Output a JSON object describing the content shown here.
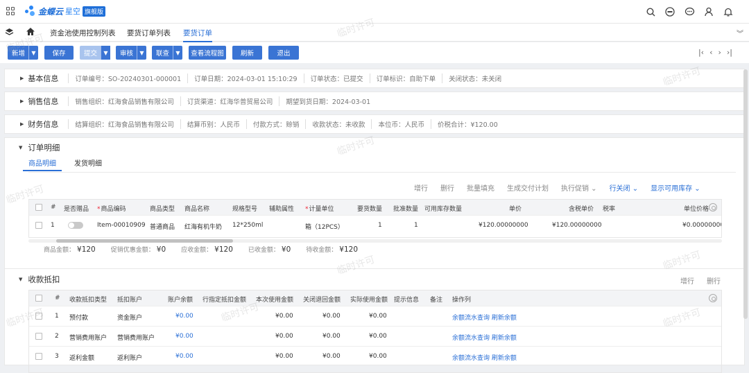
{
  "brand": {
    "name": "金蝶云",
    "sub": "星空",
    "badge": "旗舰版"
  },
  "tabs": [
    "资金池使用控制列表",
    "要货订单列表",
    "要货订单"
  ],
  "toolbar": {
    "new": "新增",
    "save": "保存",
    "submit": "提交",
    "audit": "审核",
    "link": "联查",
    "flow": "查看流程图",
    "refresh": "刷新",
    "exit": "退出"
  },
  "basic": {
    "title": "基本信息",
    "order_no": "订单编号：SO-20240301-000001",
    "order_date": "订单日期：2024-03-01 15:10:29",
    "order_status": "订单状态：已提交",
    "order_mark": "订单标识：自助下单",
    "close_status": "关闭状态：未关闭"
  },
  "sales": {
    "title": "销售信息",
    "org": "销售组织：红海食品销售有限公司",
    "channel": "订货渠道：红海华普贸易公司",
    "expected": "期望到货日期：2024-03-01"
  },
  "finance": {
    "title": "财务信息",
    "settle_org": "结算组织：红海食品销售有限公司",
    "currency": "结算币别：人民币",
    "pay": "付款方式：赊销",
    "collect": "收款状态：未收款",
    "base_currency": "本位币：人民币",
    "total": "价税合计：¥120.00"
  },
  "detail": {
    "title": "订单明细",
    "subtabs": [
      "商品明细",
      "发货明细"
    ],
    "actions": [
      "增行",
      "删行",
      "批量填充",
      "生成交付计划",
      "执行促销",
      "行关闭",
      "显示可用库存"
    ],
    "headers": [
      "#",
      "是否赠品",
      "商品编码",
      "商品类型",
      "商品名称",
      "规格型号",
      "辅助属性",
      "计量单位",
      "要货数量",
      "批准数量",
      "可用库存数量",
      "单价",
      "含税单价",
      "税率",
      "单位价格"
    ],
    "row": {
      "idx": "1",
      "code": "Item-00010909",
      "type": "普通商品",
      "name": "红海有机牛奶",
      "spec": "12*250ml",
      "unit": "箱（12PCS）",
      "qty": "1",
      "approved": "1",
      "price": "¥120.00000000",
      "tax_price": "¥120.00000000",
      "unit_price": "¥0.00000000"
    },
    "summary": [
      {
        "label": "商品金额：",
        "value": "¥120"
      },
      {
        "label": "促销优惠金额：",
        "value": "¥0"
      },
      {
        "label": "应收金额：",
        "value": "¥120"
      },
      {
        "label": "已收金额：",
        "value": "¥0"
      },
      {
        "label": "待收金额：",
        "value": "¥120"
      }
    ]
  },
  "deduction": {
    "title": "收款抵扣",
    "actions": [
      "增行",
      "删行"
    ],
    "headers": [
      "#",
      "收款抵扣类型",
      "抵扣账户",
      "账户余额",
      "行指定抵扣金额",
      "本次使用金额",
      "关闭退回金额",
      "实际使用金额",
      "提示信息",
      "备注",
      "操作列"
    ],
    "rows": [
      {
        "idx": "1",
        "type": "预付款",
        "account": "资金账户",
        "balance": "¥0.00",
        "current": "¥0.00",
        "returned": "¥0.00",
        "actual": "¥0.00",
        "ops": "余额流水查询 刷新余额"
      },
      {
        "idx": "2",
        "type": "营销费用账户",
        "account": "营销费用账户",
        "balance": "¥0.00",
        "current": "¥0.00",
        "returned": "¥0.00",
        "actual": "¥0.00",
        "ops": "余额流水查询 刷新余额"
      },
      {
        "idx": "3",
        "type": "返利金额",
        "account": "返利账户",
        "balance": "¥0.00",
        "current": "¥0.00",
        "returned": "¥0.00",
        "actual": "¥0.00",
        "ops": "余额流水查询 刷新余额"
      }
    ]
  },
  "watermark": "临时许可",
  "colors": {
    "primary": "#3a74d4",
    "link": "#2a6fd6"
  }
}
